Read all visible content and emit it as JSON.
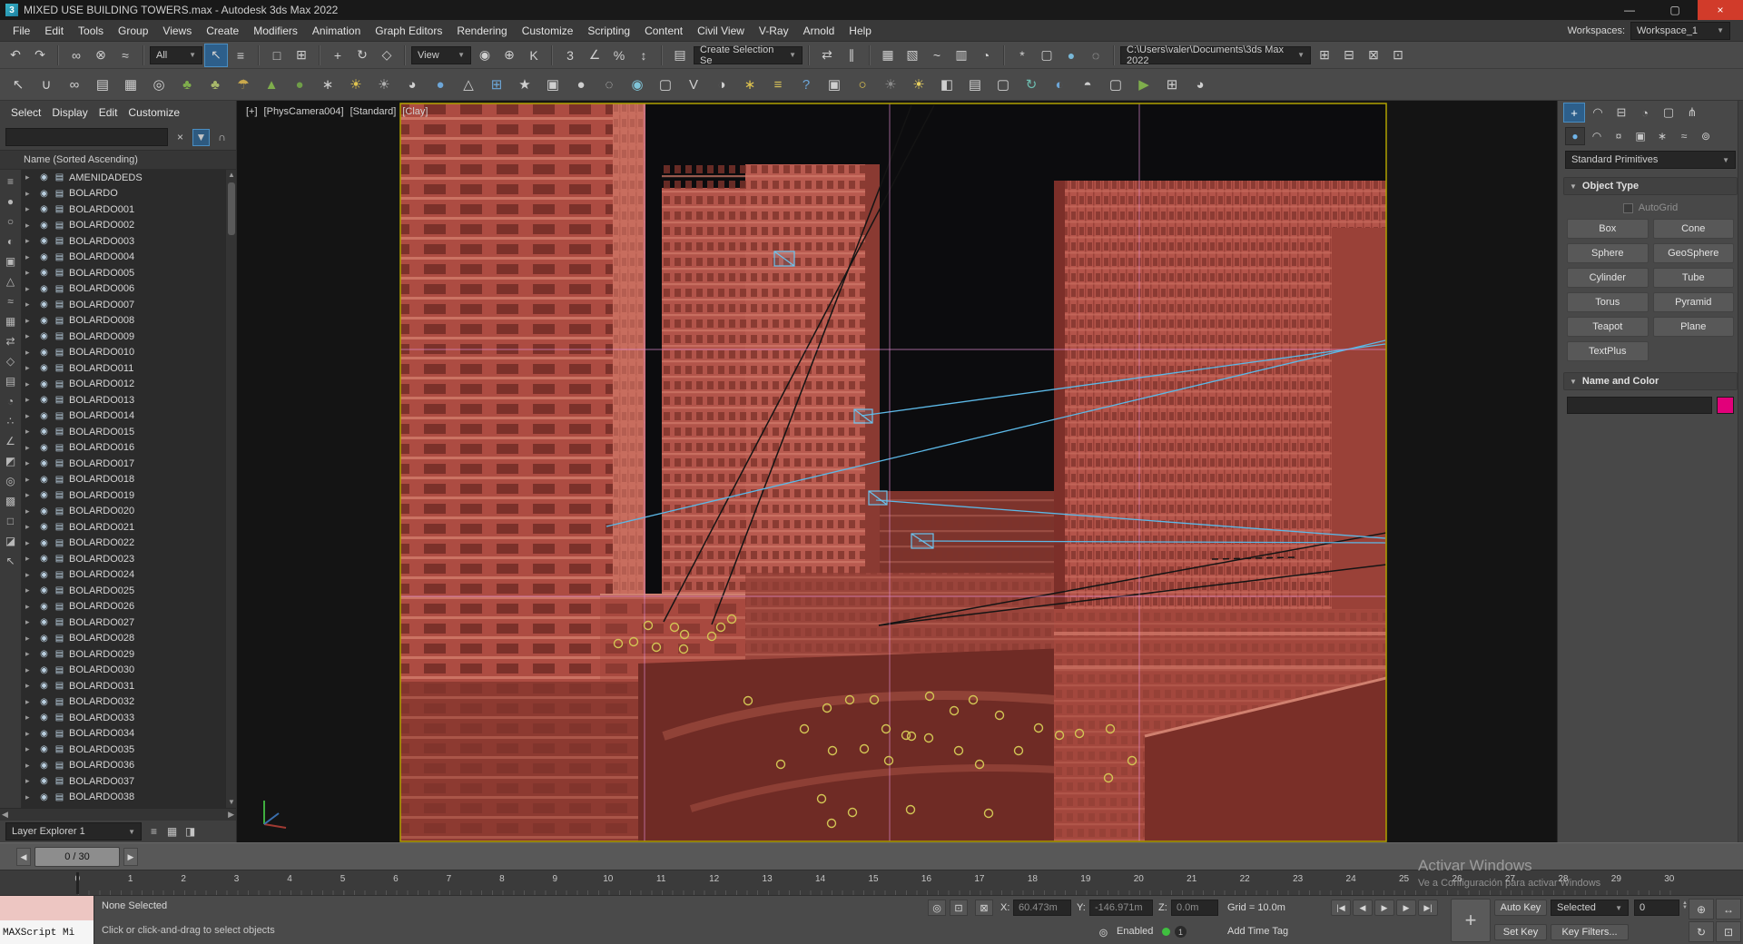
{
  "window": {
    "title": "MIXED USE BUILDING TOWERS.max - Autodesk 3ds Max 2022",
    "logo": "3",
    "minimize": "—",
    "maximize": "▢",
    "close": "×"
  },
  "menu": {
    "items": [
      "File",
      "Edit",
      "Tools",
      "Group",
      "Views",
      "Create",
      "Modifiers",
      "Animation",
      "Graph Editors",
      "Rendering",
      "Customize",
      "Scripting",
      "Content",
      "Civil View",
      "V-Ray",
      "Arnold",
      "Help"
    ],
    "workspaces_label": "Workspaces:",
    "workspace": "Workspace_1"
  },
  "toolbar1": {
    "history": [
      {
        "name": "undo-icon",
        "glyph": "↶"
      },
      {
        "name": "redo-icon",
        "glyph": "↷"
      }
    ],
    "link": [
      {
        "name": "select-and-link-icon",
        "glyph": "∞"
      },
      {
        "name": "unlink-selection-icon",
        "glyph": "⊗"
      },
      {
        "name": "bind-to-space-warp-icon",
        "glyph": "≈"
      }
    ],
    "selection_filter": "All",
    "select": [
      {
        "name": "select-object-icon",
        "glyph": "↖",
        "active": true
      },
      {
        "name": "select-by-name-icon",
        "glyph": "≡"
      }
    ],
    "region": [
      {
        "name": "rectangular-selection-region-icon",
        "glyph": "□"
      },
      {
        "name": "window-crossing-icon",
        "glyph": "⊞"
      }
    ],
    "transform": [
      {
        "name": "select-and-move-icon",
        "glyph": "+"
      },
      {
        "name": "select-and-rotate-icon",
        "glyph": "↻"
      },
      {
        "name": "select-and-scale-icon",
        "glyph": "◇"
      }
    ],
    "ref_coord": "View",
    "pivot": [
      {
        "name": "use-pivot-point-icon",
        "glyph": "◉"
      },
      {
        "name": "select-and-manipulate-icon",
        "glyph": "⊕"
      },
      {
        "name": "keyboard-override-icon",
        "glyph": "K"
      }
    ],
    "snaps": [
      {
        "name": "snaps-toggle-icon",
        "glyph": "3"
      },
      {
        "name": "angle-snap-icon",
        "glyph": "∠"
      },
      {
        "name": "percent-snap-icon",
        "glyph": "%"
      },
      {
        "name": "spinner-snap-icon",
        "glyph": "↕"
      }
    ],
    "sets": [
      {
        "name": "edit-named-selection-sets-icon",
        "glyph": "▤"
      }
    ],
    "named_selection": "Create Selection Se",
    "mirror_align": [
      {
        "name": "mirror-icon",
        "glyph": "⇄"
      },
      {
        "name": "align-icon",
        "glyph": "∥"
      }
    ],
    "editors": [
      {
        "name": "scene-explorer-icon",
        "glyph": "▦"
      },
      {
        "name": "layer-explorer-icon",
        "glyph": "▧"
      },
      {
        "name": "curve-editor-icon",
        "glyph": "~"
      },
      {
        "name": "schematic-view-icon",
        "glyph": "▥"
      },
      {
        "name": "material-editor-icon",
        "glyph": "◔"
      }
    ],
    "render": [
      {
        "name": "render-setup-icon",
        "glyph": "*"
      },
      {
        "name": "rendered-frame-icon",
        "glyph": "▢"
      },
      {
        "name": "render-production-icon",
        "glyph": "●",
        "color": "#79b8d8"
      },
      {
        "name": "render-iterative-icon",
        "glyph": "◌"
      }
    ],
    "project_path": "C:\\Users\\valer\\Documents\\3ds Max 2022",
    "right": [
      {
        "name": "import-icon",
        "glyph": "⊞"
      },
      {
        "name": "export-icon",
        "glyph": "⊟"
      },
      {
        "name": "manage-scene-icon",
        "glyph": "⊠"
      },
      {
        "name": "asset-tracking-icon",
        "glyph": "⊡"
      }
    ]
  },
  "toolbar2": {
    "icons": [
      {
        "name": "cursor-icon",
        "glyph": "↖"
      },
      {
        "name": "magnet-icon",
        "glyph": "∪"
      },
      {
        "name": "chain-icon",
        "glyph": "∞"
      },
      {
        "name": "pages-icon",
        "glyph": "▤"
      },
      {
        "name": "boxes-icon",
        "glyph": "▦"
      },
      {
        "name": "target-icon",
        "glyph": "◎"
      },
      {
        "name": "tree-icon",
        "glyph": "♣",
        "color": "#7fae4c"
      },
      {
        "name": "tree-small-icon",
        "glyph": "♣",
        "color": "#a8b86a"
      },
      {
        "name": "umbrella-icon",
        "glyph": "☂",
        "color": "#c9a84c"
      },
      {
        "name": "cone-tree-icon",
        "glyph": "▲",
        "color": "#7fae4c"
      },
      {
        "name": "bush-icon",
        "glyph": "●",
        "color": "#6f9e48"
      },
      {
        "name": "asterisk-icon",
        "glyph": "∗"
      },
      {
        "name": "sun-icon",
        "glyph": "☀",
        "color": "#e0c44f"
      },
      {
        "name": "rays-icon",
        "glyph": "☀",
        "color": "#b0b0b0"
      },
      {
        "name": "teapot-icon",
        "glyph": "◕"
      },
      {
        "name": "sphere-blue-icon",
        "glyph": "●",
        "color": "#6da6d8"
      },
      {
        "name": "axis-cone-icon",
        "glyph": "△"
      },
      {
        "name": "grid-box-icon",
        "glyph": "⊞",
        "color": "#6da6d8"
      },
      {
        "name": "star-icon",
        "glyph": "★"
      },
      {
        "name": "camera-icon",
        "glyph": "▣"
      },
      {
        "name": "sphere-gray-icon",
        "glyph": "●"
      },
      {
        "name": "sphere-dotted-icon",
        "glyph": "◌"
      },
      {
        "name": "eye-icon",
        "glyph": "◉",
        "color": "#7fc4d8"
      },
      {
        "name": "page-icon",
        "glyph": "▢"
      },
      {
        "name": "vray-icon",
        "glyph": "V"
      },
      {
        "name": "vray-sphere-icon",
        "glyph": "◑"
      },
      {
        "name": "flower-icon",
        "glyph": "∗",
        "color": "#e0c44f"
      },
      {
        "name": "list-icon",
        "glyph": "≡",
        "color": "#d8c25a"
      },
      {
        "name": "help-icon",
        "glyph": "?",
        "color": "#6da6d8"
      },
      {
        "name": "camera-add-icon",
        "glyph": "▣"
      },
      {
        "name": "lightbulb-icon",
        "glyph": "○",
        "color": "#e0c44f"
      },
      {
        "name": "sun-dark-icon",
        "glyph": "☀",
        "color": "#8a8a8a"
      },
      {
        "name": "sun-bright-icon",
        "glyph": "☀",
        "color": "#e8d060"
      },
      {
        "name": "film-camera-icon",
        "glyph": "◧"
      },
      {
        "name": "book-icon",
        "glyph": "▤"
      },
      {
        "name": "tablet-icon",
        "glyph": "▢"
      },
      {
        "name": "orbit-icon",
        "glyph": "↻",
        "color": "#6dbdb0"
      },
      {
        "name": "sphere-shaded-icon",
        "glyph": "◐",
        "color": "#6da6d8"
      },
      {
        "name": "sphere-light-icon",
        "glyph": "◓"
      },
      {
        "name": "monitor-icon",
        "glyph": "▢"
      },
      {
        "name": "play-icon",
        "glyph": "▶",
        "color": "#7fae4c"
      },
      {
        "name": "grid-icon",
        "glyph": "⊞"
      },
      {
        "name": "teapot-wrench-icon",
        "glyph": "◕"
      }
    ]
  },
  "explorer": {
    "menus": [
      "Select",
      "Display",
      "Edit",
      "Customize"
    ],
    "search_placeholder": "",
    "clear_icon": "×",
    "filter_icon": "▼",
    "lock_icon": "∩",
    "header": "Name (Sorted Ascending)",
    "row_arrow": "▸",
    "row_eye": "◉",
    "row_layer": "▤",
    "tool_icons": [
      {
        "name": "explorer-sort-icon",
        "glyph": "≡"
      },
      {
        "name": "display-geometry-icon",
        "glyph": "●"
      },
      {
        "name": "display-shapes-icon",
        "glyph": "○"
      },
      {
        "name": "display-lights-icon",
        "glyph": "◐"
      },
      {
        "name": "display-cameras-icon",
        "glyph": "▣"
      },
      {
        "name": "display-helpers-icon",
        "glyph": "△"
      },
      {
        "name": "display-spacewarps-icon",
        "glyph": "≈"
      },
      {
        "name": "display-groups-icon",
        "glyph": "▦"
      },
      {
        "name": "display-xrefs-icon",
        "glyph": "⇄"
      },
      {
        "name": "display-bones-icon",
        "glyph": "◇"
      },
      {
        "name": "display-containers-icon",
        "glyph": "▤"
      },
      {
        "name": "display-materials-icon",
        "glyph": "◔"
      },
      {
        "name": "display-particles-icon",
        "glyph": "∴"
      },
      {
        "name": "display-ik-icon",
        "glyph": "∠"
      },
      {
        "name": "display-frozen-icon",
        "glyph": "◩"
      },
      {
        "name": "display-hidden-icon",
        "glyph": "◎"
      },
      {
        "name": "select-all-icon",
        "glyph": "▩"
      },
      {
        "name": "select-none-icon",
        "glyph": "□"
      },
      {
        "name": "select-invert-icon",
        "glyph": "◪"
      },
      {
        "name": "pick-parent-icon",
        "glyph": "↖"
      }
    ],
    "items": [
      "AMENIDADEDS",
      "BOLARDO",
      "BOLARDO001",
      "BOLARDO002",
      "BOLARDO003",
      "BOLARDO004",
      "BOLARDO005",
      "BOLARDO006",
      "BOLARDO007",
      "BOLARDO008",
      "BOLARDO009",
      "BOLARDO010",
      "BOLARDO011",
      "BOLARDO012",
      "BOLARDO013",
      "BOLARDO014",
      "BOLARDO015",
      "BOLARDO016",
      "BOLARDO017",
      "BOLARDO018",
      "BOLARDO019",
      "BOLARDO020",
      "BOLARDO021",
      "BOLARDO022",
      "BOLARDO023",
      "BOLARDO024",
      "BOLARDO025",
      "BOLARDO026",
      "BOLARDO027",
      "BOLARDO028",
      "BOLARDO029",
      "BOLARDO030",
      "BOLARDO031",
      "BOLARDO032",
      "BOLARDO033",
      "BOLARDO034",
      "BOLARDO035",
      "BOLARDO036",
      "BOLARDO037",
      "BOLARDO038"
    ],
    "footer_label": "Layer Explorer 1",
    "footer_icons": [
      {
        "name": "explorer-options-icon",
        "glyph": "≡"
      },
      {
        "name": "explorer-grid-icon",
        "glyph": "▦"
      },
      {
        "name": "explorer-dock-icon",
        "glyph": "◨"
      }
    ]
  },
  "viewport": {
    "label_segments": [
      "[+]",
      "[PhysCamera004]",
      "[Standard]",
      "[Clay]"
    ]
  },
  "command_panel": {
    "tabs": [
      {
        "name": "tab-create",
        "glyph": "+",
        "active": true
      },
      {
        "name": "tab-modify",
        "glyph": "◠"
      },
      {
        "name": "tab-hierarchy",
        "glyph": "⊟"
      },
      {
        "name": "tab-motion",
        "glyph": "◔"
      },
      {
        "name": "tab-display",
        "glyph": "▢"
      },
      {
        "name": "tab-utilities",
        "glyph": "⋔"
      }
    ],
    "categories": [
      {
        "name": "category-geometry",
        "glyph": "●",
        "active": true
      },
      {
        "name": "category-shapes",
        "glyph": "◠"
      },
      {
        "name": "category-lights",
        "glyph": "¤"
      },
      {
        "name": "category-cameras",
        "glyph": "▣"
      },
      {
        "name": "category-helpers",
        "glyph": "∗"
      },
      {
        "name": "category-space-warps",
        "glyph": "≈"
      },
      {
        "name": "category-systems",
        "glyph": "⊚"
      }
    ],
    "object_category": "Standard Primitives",
    "rollout_object_type": "Object Type",
    "autogrid_label": "AutoGrid",
    "buttons": [
      "Box",
      "Cone",
      "Sphere",
      "GeoSphere",
      "Cylinder",
      "Tube",
      "Torus",
      "Pyramid",
      "Teapot",
      "Plane",
      "TextPlus"
    ],
    "rollout_name_color": "Name and Color",
    "color_swatch": "#e2007a"
  },
  "timeline": {
    "prev_icon": "◀",
    "next_icon": "▶",
    "slider_value": "0 / 30",
    "ticks": [
      "0",
      "1",
      "2",
      "3",
      "4",
      "5",
      "6",
      "7",
      "8",
      "9",
      "10",
      "11",
      "12",
      "13",
      "14",
      "15",
      "16",
      "17",
      "18",
      "19",
      "20",
      "21",
      "22",
      "23",
      "24",
      "25",
      "26",
      "27",
      "28",
      "29",
      "30"
    ]
  },
  "status": {
    "maxscript_label": "MAXScript Mi",
    "selection": "None Selected",
    "prompt": "Click or click-and-drag to select objects",
    "isolate_icon": "◎",
    "offset_icon": "⊡",
    "lock_icon": "⊠",
    "x_label": "X:",
    "x_value": "60.473m",
    "y_label": "Y:",
    "y_value": "-146.971m",
    "z_label": "Z:",
    "z_value": "0.0m",
    "grid": "Grid = 10.0m",
    "progressive_icon": "⊚",
    "progressive_label": "Enabled",
    "info_badge": "1",
    "add_time_tag": "Add Time Tag",
    "playback": [
      {
        "name": "go-to-start-button",
        "glyph": "|◀"
      },
      {
        "name": "previous-frame-button",
        "glyph": "◀"
      },
      {
        "name": "play-button",
        "glyph": "▶"
      },
      {
        "name": "next-frame-button",
        "glyph": "▶"
      },
      {
        "name": "go-to-end-button",
        "glyph": "▶|"
      }
    ],
    "set_key_mode_glyph": "+",
    "auto_key": "Auto Key",
    "set_key": "Set Key",
    "selected_dropdown": "Selected",
    "key_filters": "Key Filters...",
    "frame": "0",
    "nav": [
      {
        "name": "zoom-icon",
        "glyph": "⊕"
      },
      {
        "name": "pan-icon",
        "glyph": "↔"
      },
      {
        "name": "orbit-icon",
        "glyph": "↻"
      },
      {
        "name": "maximize-viewport-icon",
        "glyph": "⊡"
      }
    ]
  },
  "watermark": {
    "line1": "Activar Windows",
    "line2": "Ve a Configuración para activar Windows"
  }
}
